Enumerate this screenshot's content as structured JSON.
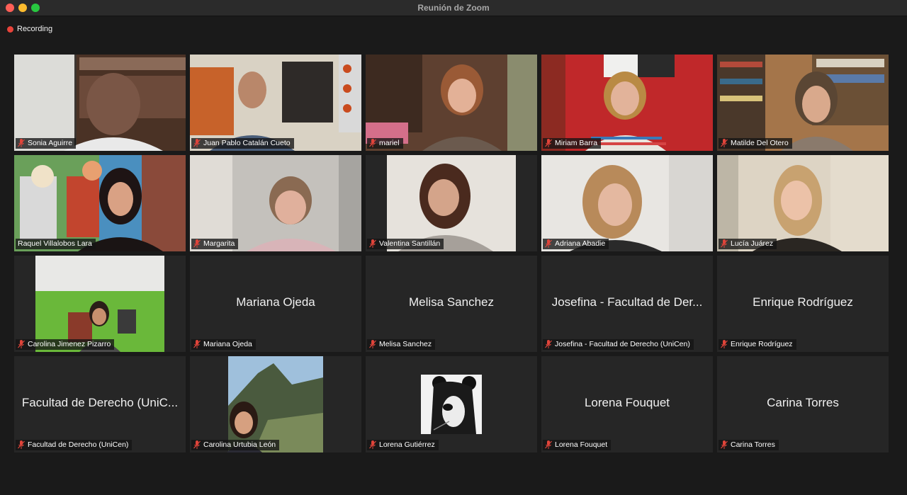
{
  "window": {
    "title": "Reunión de Zoom"
  },
  "recording": {
    "label": "Recording"
  },
  "participants": [
    {
      "name": "Sonia Aguirre",
      "muted": true
    },
    {
      "name": "Juan Pablo Catalán Cueto",
      "muted": true
    },
    {
      "name": "mariel",
      "muted": true
    },
    {
      "name": "Miriam Barra",
      "muted": true
    },
    {
      "name": "Matilde Del Otero",
      "muted": true
    },
    {
      "name": "Raquel Villalobos Lara",
      "muted": false,
      "active_speaker": true
    },
    {
      "name": "Margarita",
      "muted": true
    },
    {
      "name": "Valentina Santillán",
      "muted": true
    },
    {
      "name": "Adriana Abadie",
      "muted": true
    },
    {
      "name": "Lucía Juárez",
      "muted": true
    },
    {
      "name": "Carolina Jimenez Pizarro",
      "muted": true
    },
    {
      "name": "Mariana Ojeda",
      "display_name": "Mariana Ojeda",
      "muted": true
    },
    {
      "name": "Melisa Sanchez",
      "display_name": "Melisa Sanchez",
      "muted": true
    },
    {
      "name": "Josefina - Facultad de Derecho (UniCen)",
      "display_name": "Josefina - Facultad de Der...",
      "muted": true
    },
    {
      "name": "Enrique Rodríguez",
      "display_name": "Enrique Rodríguez",
      "muted": true
    },
    {
      "name": "Facultad de Derecho (UniCen)",
      "display_name": "Facultad de Derecho (UniC...",
      "muted": true
    },
    {
      "name": "Carolina Urtubia León",
      "muted": true
    },
    {
      "name": "Lorena Gutiérrez",
      "muted": true
    },
    {
      "name": "Lorena Fouquet",
      "display_name": "Lorena Fouquet",
      "muted": true
    },
    {
      "name": "Carina Torres",
      "display_name": "Carina Torres",
      "muted": true
    }
  ],
  "colors": {
    "active_speaker_border": "#f4f09a",
    "muted_icon": "#e0443a",
    "tile_bg": "#262626"
  }
}
